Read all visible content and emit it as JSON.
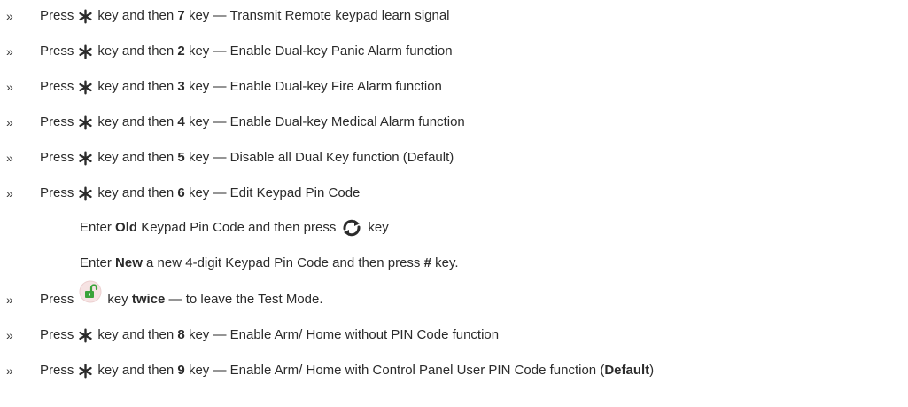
{
  "bullet": "»",
  "icons": {
    "star": "asterisk-key-icon",
    "refresh": "refresh-key-icon",
    "unlock": "unlock-key-icon"
  },
  "colors": {
    "text": "#2b2b2b",
    "unlock_green": "#3aa33a",
    "unlock_bg": "#f6e3e3"
  },
  "common": {
    "press": "Press",
    "key_and_then": "key and then",
    "key_dash": "key —",
    "key": "key"
  },
  "items": [
    {
      "num": "7",
      "desc": "Transmit Remote keypad learn signal"
    },
    {
      "num": "2",
      "desc": "Enable Dual-key Panic Alarm function"
    },
    {
      "num": "3",
      "desc": "Enable Dual-key Fire Alarm function"
    },
    {
      "num": "4",
      "desc": "Enable Dual-key Medical Alarm function"
    },
    {
      "num": "5",
      "desc": "Disable all Dual Key function (Default)"
    },
    {
      "num": "6",
      "desc": "Edit Keypad Pin Code"
    }
  ],
  "sub1": {
    "pre": "Enter",
    "bold": "Old",
    "mid": "Keypad Pin Code and then press",
    "post": "key"
  },
  "sub2": {
    "pre": "Enter",
    "bold": "New",
    "mid": "a new 4-digit Keypad Pin Code and then press",
    "hash": "#",
    "post": "key."
  },
  "test_mode": {
    "press": "Press",
    "key": "key",
    "twice": "twice",
    "rest": "— to leave the Test Mode."
  },
  "items2": [
    {
      "num": "8",
      "desc": "Enable Arm/ Home without PIN Code function"
    }
  ],
  "last": {
    "num": "9",
    "desc": "Enable Arm/ Home with Control Panel User PIN Code function (",
    "bold": "Default",
    "close": ")"
  }
}
